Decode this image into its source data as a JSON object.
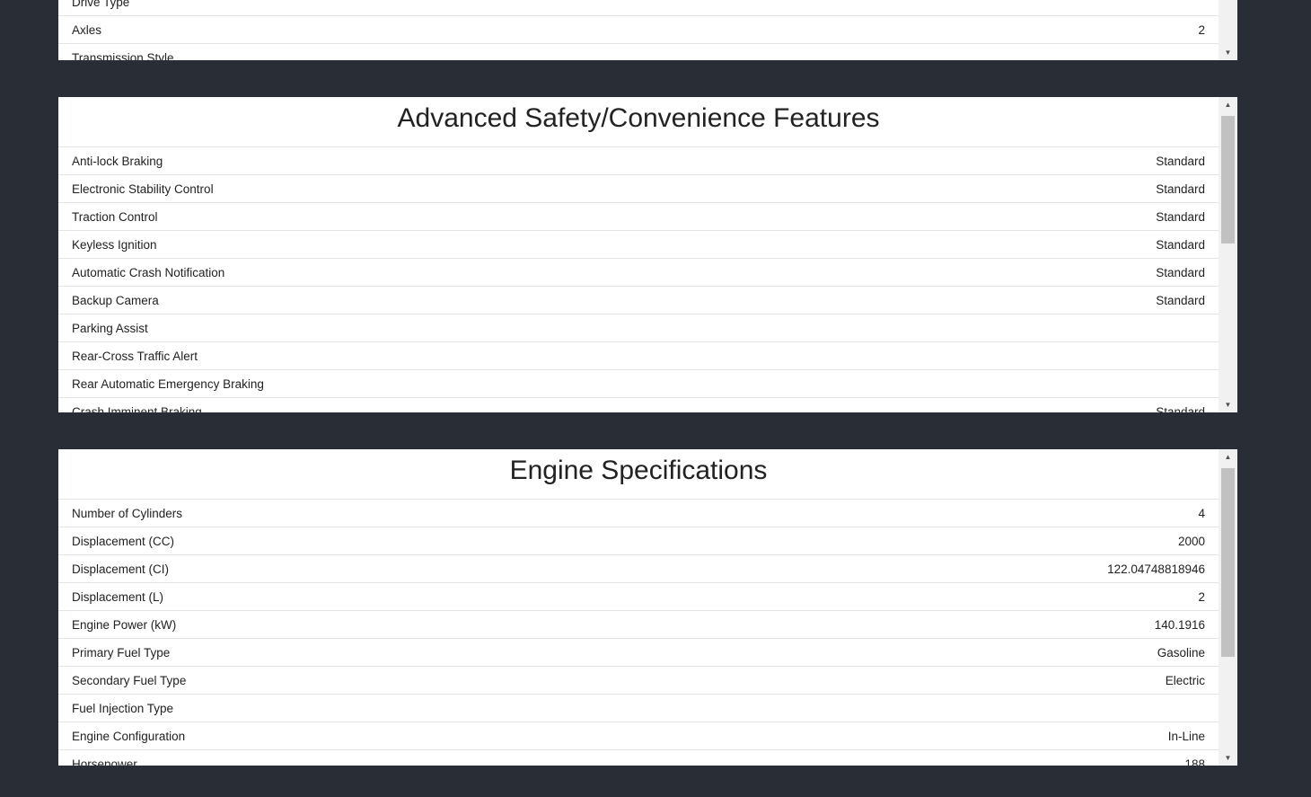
{
  "top_panel": {
    "rows": [
      {
        "label": "Drive Type",
        "value": ""
      },
      {
        "label": "Axles",
        "value": "2"
      },
      {
        "label": "Transmission Style",
        "value": ""
      }
    ]
  },
  "safety_panel": {
    "title": "Advanced Safety/Convenience Features",
    "rows": [
      {
        "label": "Anti-lock Braking",
        "value": "Standard"
      },
      {
        "label": "Electronic Stability Control",
        "value": "Standard"
      },
      {
        "label": "Traction Control",
        "value": "Standard"
      },
      {
        "label": "Keyless Ignition",
        "value": "Standard"
      },
      {
        "label": "Automatic Crash Notification",
        "value": "Standard"
      },
      {
        "label": "Backup Camera",
        "value": "Standard"
      },
      {
        "label": "Parking Assist",
        "value": ""
      },
      {
        "label": "Rear-Cross Traffic Alert",
        "value": ""
      },
      {
        "label": "Rear Automatic Emergency Braking",
        "value": ""
      },
      {
        "label": "Crash Imminent Braking",
        "value": "Standard"
      }
    ]
  },
  "engine_panel": {
    "title": "Engine Specifications",
    "rows": [
      {
        "label": "Number of Cylinders",
        "value": "4"
      },
      {
        "label": "Displacement (CC)",
        "value": "2000"
      },
      {
        "label": "Displacement (CI)",
        "value": "122.04748818946"
      },
      {
        "label": "Displacement (L)",
        "value": "2"
      },
      {
        "label": "Engine Power (kW)",
        "value": "140.1916"
      },
      {
        "label": "Primary Fuel Type",
        "value": "Gasoline"
      },
      {
        "label": "Secondary Fuel Type",
        "value": "Electric"
      },
      {
        "label": "Fuel Injection Type",
        "value": ""
      },
      {
        "label": "Engine Configuration",
        "value": "In-Line"
      },
      {
        "label": "Horsepower",
        "value": "188"
      }
    ]
  },
  "icons": {
    "scroll_up": "triangle-up-icon",
    "scroll_down": "triangle-down-icon"
  },
  "colors": {
    "page_background": "#292d35",
    "panel_background": "#ffffff",
    "scrollbar_track": "#f1f1f1",
    "scrollbar_thumb": "#c1c1c1"
  }
}
